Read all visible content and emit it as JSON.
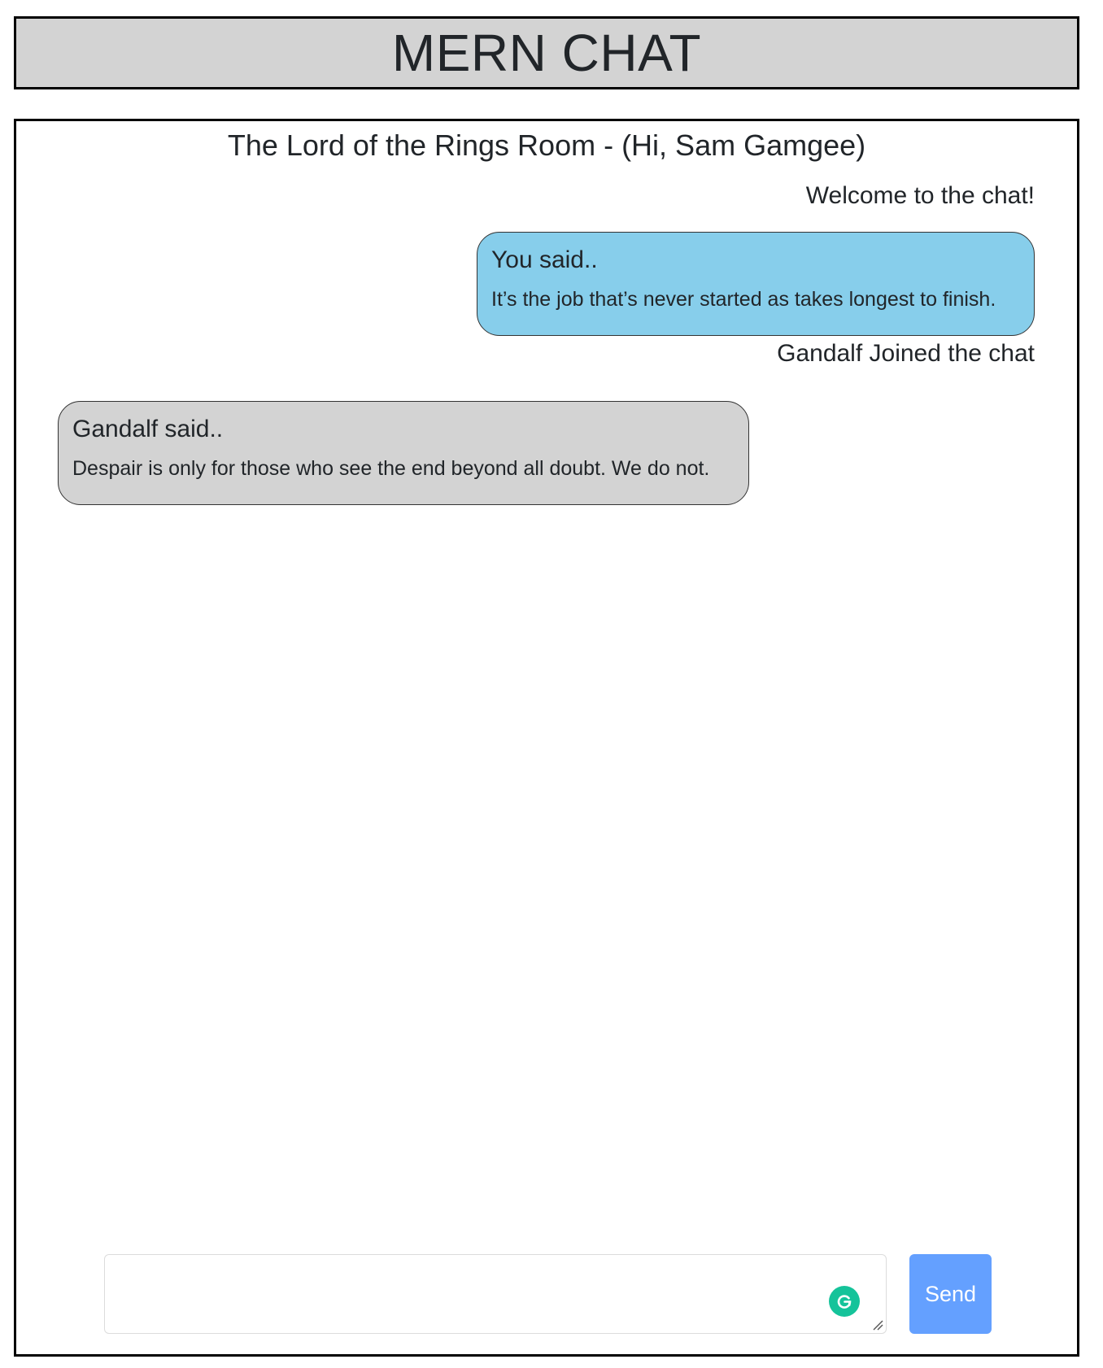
{
  "header": {
    "title": "MERN CHAT"
  },
  "room": {
    "title": "The Lord of the Rings Room - (Hi, Sam Gamgee)"
  },
  "messages": [
    {
      "type": "system",
      "text": "Welcome to the chat!"
    },
    {
      "type": "self",
      "author_label": "You said..",
      "text": "It’s the job that’s never started as takes longest to finish."
    },
    {
      "type": "system",
      "text": "Gandalf Joined the chat"
    },
    {
      "type": "other",
      "author_label": "Gandalf said..",
      "text": "Despair is only for those who see the end beyond all doubt. We do not."
    }
  ],
  "composer": {
    "value": "",
    "send_label": "Send",
    "grammar_icon": "grammarly-icon"
  },
  "colors": {
    "header_bg": "#d3d3d3",
    "self_bubble": "#87ceeb",
    "other_bubble": "#d3d3d3",
    "send_button": "#64a0ff",
    "grammar_badge": "#15c39a"
  }
}
